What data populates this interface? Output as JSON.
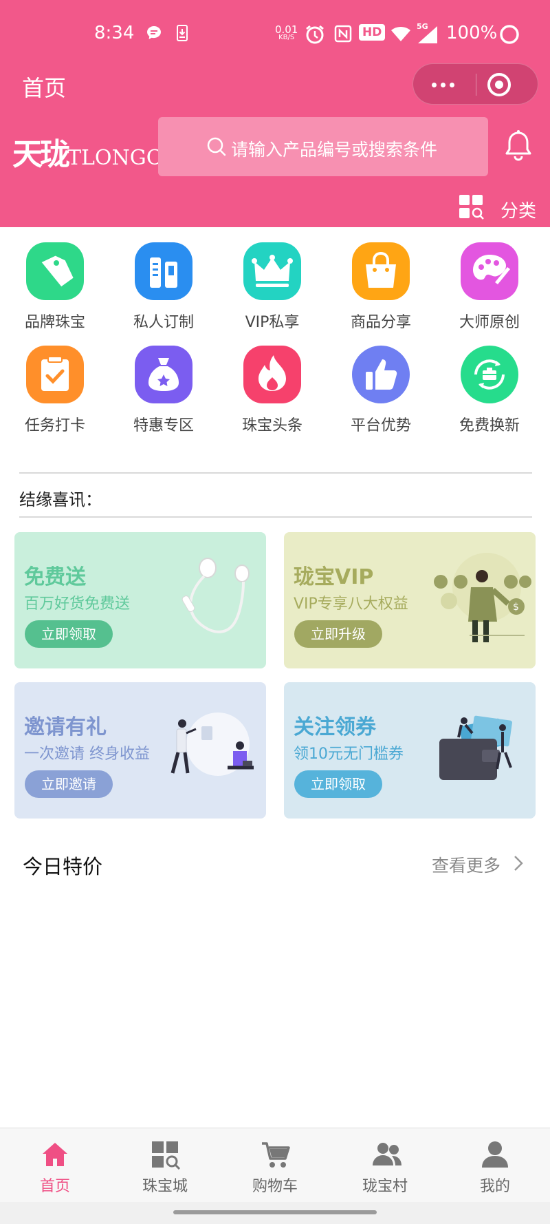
{
  "status_bar": {
    "time": "8:34",
    "net_speed_value": "0.01",
    "net_speed_unit": "KB/S",
    "badge_hd": "HD",
    "badge_5g": "5G",
    "battery": "100%"
  },
  "nav": {
    "title": "首页"
  },
  "header": {
    "logo_cn": "天珑",
    "logo_en": "TLONGCN",
    "search_placeholder": "请输入产品编号或搜索条件",
    "category_label": "分类"
  },
  "grid": {
    "items": [
      {
        "label": "品牌珠宝",
        "icon": "tag-icon",
        "color": "#2ed889"
      },
      {
        "label": "私人订制",
        "icon": "tools-icon",
        "color": "#2a8ef0"
      },
      {
        "label": "VIP私享",
        "icon": "crown-icon",
        "color": "#23d3c2"
      },
      {
        "label": "商品分享",
        "icon": "bag-icon",
        "color": "#ffa514"
      },
      {
        "label": "大师原创",
        "icon": "palette-icon",
        "color": "#e356e0"
      },
      {
        "label": "任务打卡",
        "icon": "clipboard-check-icon",
        "color": "#ff8f2a"
      },
      {
        "label": "特惠专区",
        "icon": "money-bag-icon",
        "color": "#7b5df0"
      },
      {
        "label": "珠宝头条",
        "icon": "flame-icon",
        "color": "#f6416c"
      },
      {
        "label": "平台优势",
        "icon": "thumbs-up-icon",
        "color": "#6f7ff2"
      },
      {
        "label": "免费换新",
        "icon": "refresh-box-icon",
        "color": "#26dc8c"
      }
    ]
  },
  "notice": {
    "label": "结缘喜讯："
  },
  "cards": [
    {
      "title": "免费送",
      "subtitle": "百万好货免费送",
      "button": "立即领取",
      "bg": "#c9efdc",
      "title_color": "#5fc99b",
      "sub_color": "#5fc99b",
      "btn_color": "#55c08f"
    },
    {
      "title": "珑宝VIP",
      "subtitle": "VIP专享八大权益",
      "button": "立即升级",
      "bg": "#e9ecc6",
      "title_color": "#a6ab5d",
      "sub_color": "#a6ab5d",
      "btn_color": "#a1a862"
    },
    {
      "title": "邀请有礼",
      "subtitle": "一次邀请  终身收益",
      "button": "立即邀请",
      "bg": "#dde6f4",
      "title_color": "#7e95cf",
      "sub_color": "#7e95cf",
      "btn_color": "#8aa1d6"
    },
    {
      "title": "关注领券",
      "subtitle": "领10元无门槛券",
      "button": "立即领取",
      "bg": "#d7e8f1",
      "title_color": "#4aa8d3",
      "sub_color": "#4aa8d3",
      "btn_color": "#56b3db"
    }
  ],
  "specials": {
    "title": "今日特价",
    "more": "查看更多"
  },
  "tabbar": {
    "active_color": "#ef4f84",
    "items": [
      {
        "label": "首页",
        "icon": "home-icon"
      },
      {
        "label": "珠宝城",
        "icon": "grid-search-icon"
      },
      {
        "label": "购物车",
        "icon": "cart-icon"
      },
      {
        "label": "珑宝村",
        "icon": "users-icon"
      },
      {
        "label": "我的",
        "icon": "user-icon"
      }
    ]
  }
}
